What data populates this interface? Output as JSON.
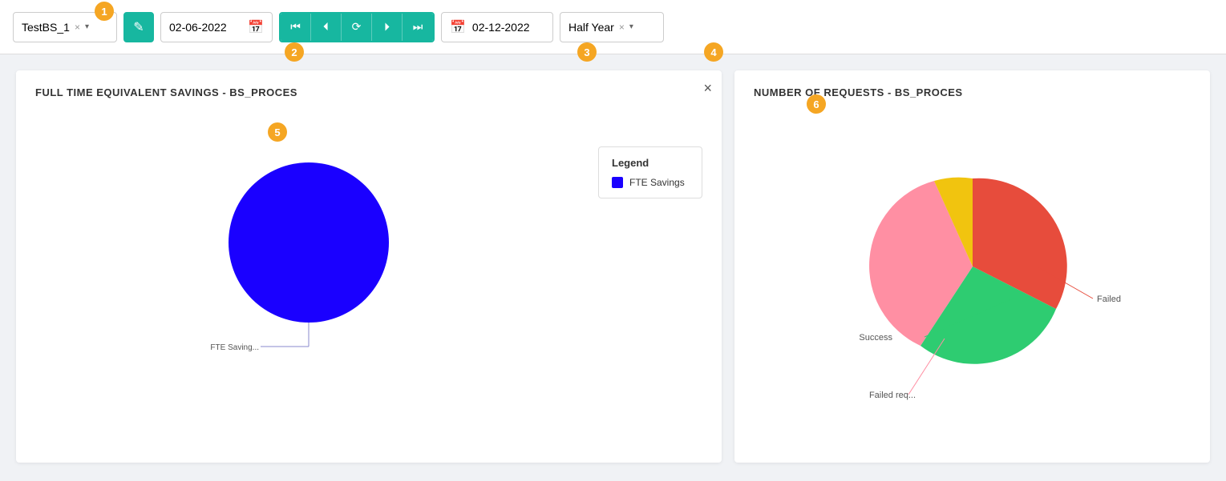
{
  "toolbar": {
    "badge1": "1",
    "badge2": "2",
    "badge3": "3",
    "badge4": "4",
    "badge5": "5",
    "badge6": "6",
    "selector_value": "TestBS_1",
    "date_start": "02-06-2022",
    "date_end": "02-12-2022",
    "period": "Half Year",
    "close_label": "×",
    "edit_icon": "✎",
    "calendar_icon": "📅",
    "nav_first": "⏮",
    "nav_prev": "⏴",
    "nav_refresh": "⟳",
    "nav_next": "⏵",
    "nav_last": "⏭"
  },
  "left_chart": {
    "title": "FULL TIME EQUIVALENT SAVINGS - BS_PROCES",
    "legend_title": "Legend",
    "legend_items": [
      {
        "label": "FTE Savings",
        "color": "#1a00ff"
      }
    ],
    "fte_label": "FTE Saving..."
  },
  "right_chart": {
    "title": "NUMBER OF REQUESTS - BS_PROCES",
    "labels": {
      "success": "Success",
      "failed": "Failed",
      "failed_req": "Failed req..."
    }
  }
}
